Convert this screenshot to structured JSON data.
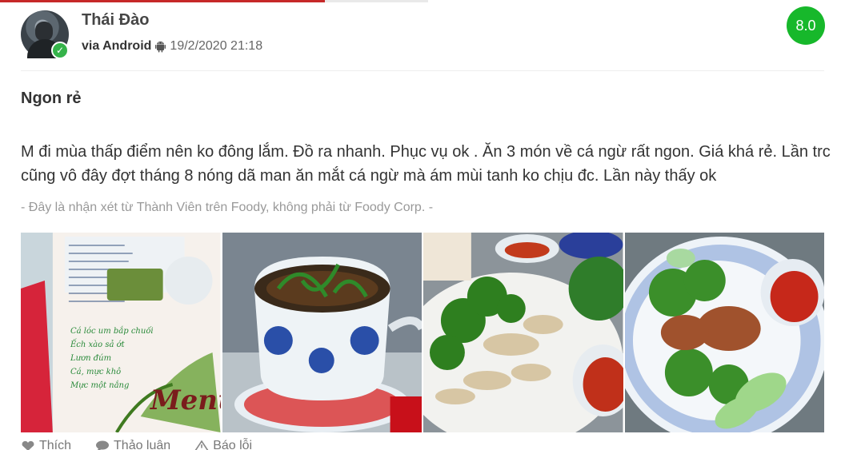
{
  "review": {
    "user_name": "Thái Đào",
    "via_label": "via Android",
    "device_icon": "android-icon",
    "timestamp": "19/2/2020 21:18",
    "score": "8.0",
    "title": "Ngon rẻ",
    "body": "M đi mùa thấp điểm nên ko đông lắm. Đồ ra nhanh. Phục vụ ok . Ăn 3 món về cá ngừ rất ngon. Giá khá rẻ. Lần trc cũng vô đây đợt tháng 8 nóng dã man ăn mắt cá ngừ mà ám mùi tanh ko chịu đc. Lần này thấy ok",
    "disclaimer": "- Đây là nhận xét từ Thành Viên trên Foody, không phải từ Foody Corp. -"
  },
  "photos": [
    {
      "name": "menu-photo"
    },
    {
      "name": "fish-pot-photo"
    },
    {
      "name": "grilled-fish-photo"
    },
    {
      "name": "fish-salad-photo"
    }
  ],
  "menu_photo_text": {
    "items": [
      "Cá lóc um bắp chuối",
      "Ếch xào sả ớt",
      "Lươn đúm",
      "Cá, mực khô",
      "Mực một nắng"
    ],
    "heading": "Menu"
  },
  "actions": [
    {
      "label": "Thích",
      "icon": "heart-icon"
    },
    {
      "label": "Thảo luận",
      "icon": "comment-icon"
    },
    {
      "label": "Báo lỗi",
      "icon": "warning-icon"
    }
  ],
  "colors": {
    "score_badge": "#17b82b",
    "verified_badge": "#35b34a",
    "progress_red": "#c62828"
  }
}
